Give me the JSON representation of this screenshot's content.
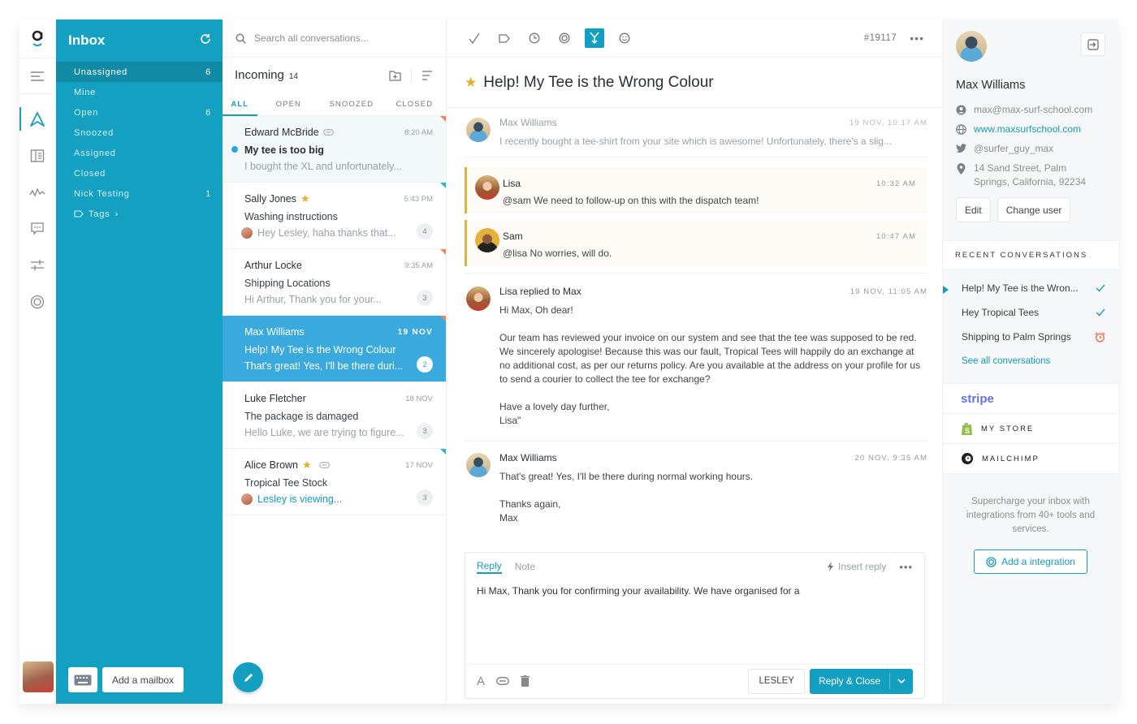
{
  "mailbox": {
    "title": "Inbox",
    "items": [
      {
        "label": "Unassigned",
        "count": "6"
      },
      {
        "label": "Mine",
        "count": ""
      },
      {
        "label": "Open",
        "count": "6"
      },
      {
        "label": "Snoozed",
        "count": ""
      },
      {
        "label": "Assigned",
        "count": ""
      },
      {
        "label": "Closed",
        "count": ""
      },
      {
        "label": "Nick Testing",
        "count": "1"
      }
    ],
    "tags_label": "Tags",
    "add_mailbox_label": "Add a mailbox"
  },
  "list": {
    "search_placeholder": "Search all conversations...",
    "heading": "Incoming",
    "heading_count": "14",
    "tabs": [
      "ALL",
      "OPEN",
      "SNOOZED",
      "CLOSED"
    ],
    "conversations": [
      {
        "name": "Edward McBride",
        "time": "8:20 AM",
        "subject": "My tee is too big",
        "preview": "I bought the XL and unfortunately...",
        "count": ""
      },
      {
        "name": "Sally Jones",
        "time": "5:43 PM",
        "subject": "Washing instructions",
        "preview": "Hey Lesley, haha thanks that...",
        "count": "4"
      },
      {
        "name": "Arthur Locke",
        "time": "9:35 AM",
        "subject": "Shipping Locations",
        "preview": "Hi Arthur, Thank you for your...",
        "count": "3"
      },
      {
        "name": "Max Williams",
        "time": "19 NOV",
        "subject": "Help! My Tee is the Wrong Colour",
        "preview": "That's great! Yes, I'll be there duri...",
        "count": "2"
      },
      {
        "name": "Luke Fletcher",
        "time": "18 NOV",
        "subject": "The package is damaged",
        "preview": "Hello Luke, we are trying to figure...",
        "count": "3"
      },
      {
        "name": "Alice Brown",
        "time": "17 NOV",
        "subject": "Tropical Tee Stock",
        "preview": "Lesley is viewing...",
        "count": "3"
      }
    ]
  },
  "main": {
    "ticket_number": "#19117",
    "title": "Help! My Tee is the Wrong Colour",
    "messages": [
      {
        "author": "Max Williams",
        "date": "19 NOV, 10:17 AM",
        "body": "I recently bought a tee-shirt from your site which is awesome! Unfortunately, there's a slig..."
      },
      {
        "author": "Lisa",
        "date": "10:32 AM",
        "body": "@sam We need to follow-up on this with the dispatch team!"
      },
      {
        "author": "Sam",
        "date": "10:47 AM",
        "body": "@lisa No worries, will do."
      },
      {
        "author": "Lisa replied to Max",
        "date": "19 NOV, 11:05 AM",
        "body": "Hi Max, Oh dear!\n\nOur team has reviewed your invoice on our system and see that the tee was supposed to be red. We sincerely apologise! Because this was our fault, Tropical Tees will happily do an exchange at no additional cost, as per our returns policy. Are you available at the address on your profile for us to send a courier to collect the tee for exchange?\n\nHave a lovely day further,\nLisa\""
      },
      {
        "author": "Max Williams",
        "date": "20 NOV, 9:35 AM",
        "body": "That's great! Yes, I'll be there during normal working hours.\n\nThanks again,\nMax"
      }
    ],
    "composer": {
      "tab_reply": "Reply",
      "tab_note": "Note",
      "insert_reply": "Insert reply",
      "text": "Hi Max, Thank you for confirming your availability. We have organised for a",
      "assignee": "LESLEY",
      "send_label": "Reply & Close"
    }
  },
  "profile": {
    "name": "Max Williams",
    "email": "max@max-surf-school.com",
    "website": "www.maxsurfschool.com",
    "twitter": "@surfer_guy_max",
    "address": "14 Sand Street, Palm Springs, California, 92234",
    "edit_label": "Edit",
    "change_user_label": "Change user",
    "recent_heading": "RECENT CONVERSATIONS",
    "recent": [
      {
        "title": "Help! My Tee is the Wron...",
        "status": "closed"
      },
      {
        "title": "Hey Tropical Tees",
        "status": "closed"
      },
      {
        "title": "Shipping to Palm Springs",
        "status": "snoozed"
      }
    ],
    "see_all": "See all conversations",
    "integrations": [
      {
        "name": "stripe"
      },
      {
        "name": "MY STORE"
      },
      {
        "name": "MAILCHIMP"
      }
    ],
    "promo": "Supercharge your inbox with integrations from 40+ tools and services.",
    "add_integration": "Add a integration"
  },
  "colors": {
    "brand": "#14a0c0",
    "selected_conversation": "#3aaade",
    "star": "#e1b12c",
    "note_border": "#d9b53d",
    "snooze": "#e8675a"
  }
}
